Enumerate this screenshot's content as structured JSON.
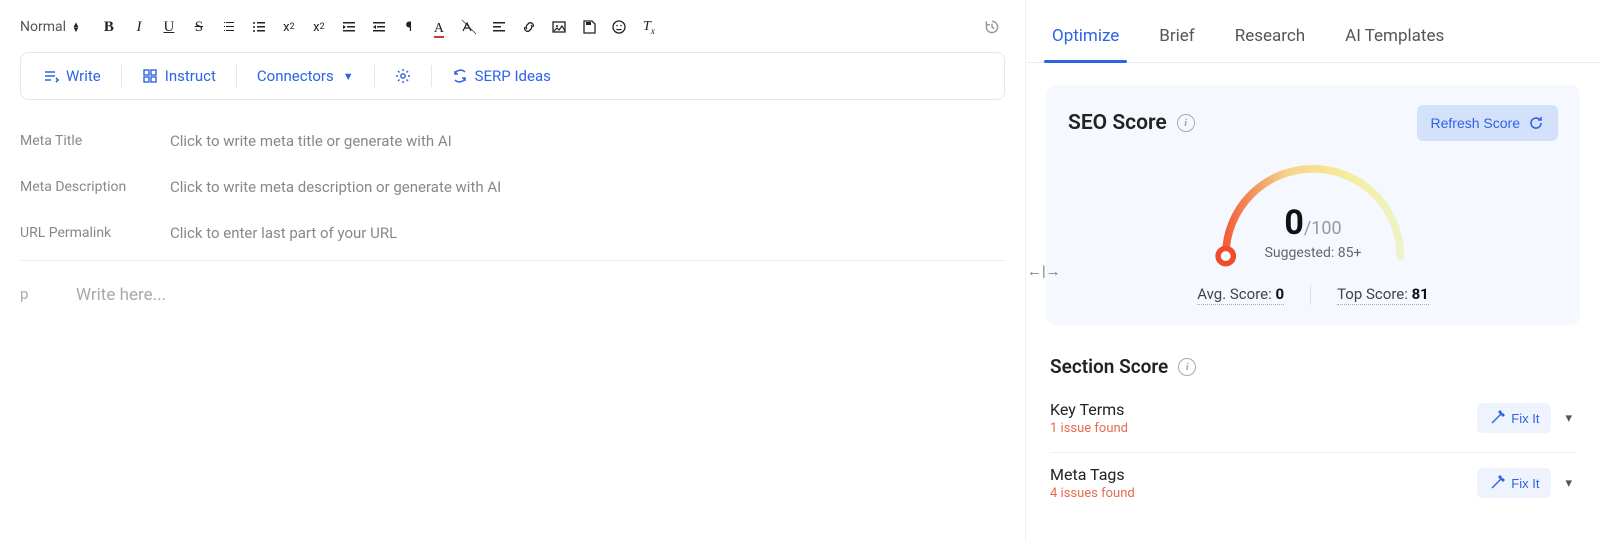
{
  "toolbar": {
    "format_label": "Normal",
    "ai": {
      "write": "Write",
      "instruct": "Instruct",
      "connectors": "Connectors",
      "serp_ideas": "SERP Ideas"
    }
  },
  "meta": {
    "title_label": "Meta Title",
    "title_placeholder": "Click to write meta title or generate with AI",
    "desc_label": "Meta Description",
    "desc_placeholder": "Click to write meta description or generate with AI",
    "url_label": "URL Permalink",
    "url_placeholder": "Click to enter last part of your URL"
  },
  "editor": {
    "tag": "p",
    "placeholder": "Write here..."
  },
  "tabs": {
    "optimize": "Optimize",
    "brief": "Brief",
    "research": "Research",
    "ai_templates": "AI Templates"
  },
  "seo": {
    "title": "SEO Score",
    "refresh": "Refresh Score",
    "value": "0",
    "max": "/100",
    "suggested": "Suggested: 85+",
    "avg_label": "Avg. Score: ",
    "avg_value": "0",
    "top_label": "Top Score: ",
    "top_value": "81"
  },
  "section": {
    "title": "Section Score",
    "fix": "Fix It",
    "items": [
      {
        "name": "Key Terms",
        "issues": "1 issue found"
      },
      {
        "name": "Meta Tags",
        "issues": "4 issues found"
      }
    ]
  }
}
